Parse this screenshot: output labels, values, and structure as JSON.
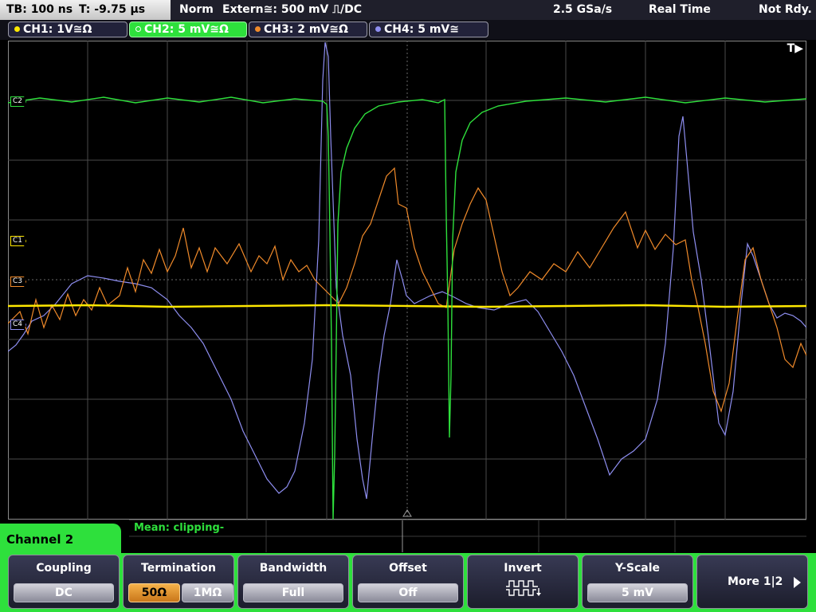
{
  "status": {
    "timebase": "TB: 100 ns",
    "trigger_time": "T: -9.75 µs",
    "mode": "Norm",
    "trigger_source": "Extern≅: 500 mV ⎍/DC",
    "sample_rate": "2.5 GSa/s",
    "acq_mode": "Real Time",
    "state": "Not Rdy."
  },
  "channels": [
    {
      "label": "CH1: 1V≅Ω",
      "color": "#ffe800",
      "active": false
    },
    {
      "label": "CH2: 5 mV≅Ω",
      "color": "#2ee03c",
      "active": true
    },
    {
      "label": "CH3: 2 mV≅Ω",
      "color": "#f08a2a",
      "active": false
    },
    {
      "label": "CH4: 5 mV≅",
      "color": "#8e8ef0",
      "active": false
    }
  ],
  "markers": {
    "trigger": "T▶",
    "ch2": "C2",
    "ch1": "C1",
    "ch3": "C3",
    "ch4": "C4"
  },
  "measurement": {
    "text": "Mean: clipping-"
  },
  "menu": {
    "title": "Channel 2",
    "coupling": {
      "label": "Coupling",
      "value": "DC"
    },
    "termination": {
      "label": "Termination",
      "options": [
        "50Ω",
        "1MΩ"
      ],
      "selected": "50Ω"
    },
    "bandwidth": {
      "label": "Bandwidth",
      "value": "Full"
    },
    "offset": {
      "label": "Offset",
      "value": "Off"
    },
    "invert": {
      "label": "Invert",
      "icon": "invert-waveform-icon"
    },
    "y_scale": {
      "label": "Y-Scale",
      "value": "5 mV"
    },
    "more": {
      "label": "More 1|2",
      "icon": "arrow-right-icon"
    }
  }
}
